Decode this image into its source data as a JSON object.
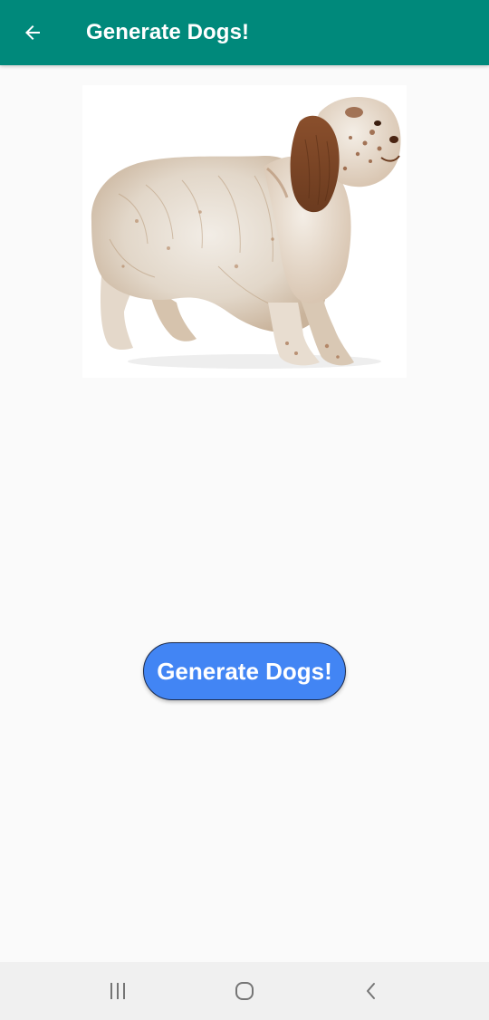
{
  "app_bar": {
    "title": "Generate Dogs!",
    "back_icon": "arrow-back-icon",
    "background_color": "#00897b"
  },
  "main": {
    "image_subject": "dog",
    "button_label": "Generate Dogs!",
    "button_color": "#4285f4"
  },
  "nav_bar": {
    "recents_icon": "recents-icon",
    "home_icon": "home-icon",
    "back_icon": "back-icon"
  }
}
